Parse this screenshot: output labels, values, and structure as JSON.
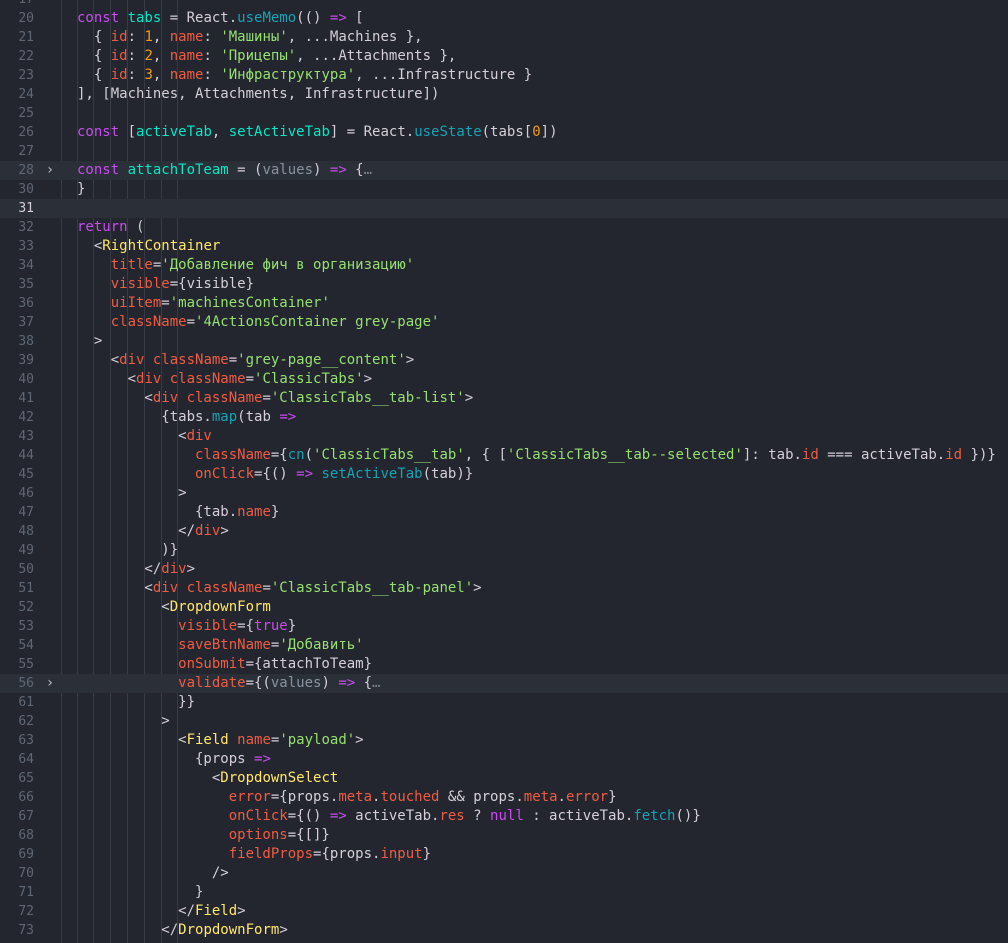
{
  "editor": {
    "language": "jsx",
    "theme_colors": {
      "background": "#23262e",
      "keyword": "#c74ded",
      "string": "#96e072",
      "tag": "#ffe66d",
      "attribute": "#ee5d43",
      "function": "#16a3b6",
      "number": "#f39c12"
    },
    "fold_icon": "chevron-right-icon",
    "current_line": 31,
    "lines": [
      {
        "n": "17",
        "fold": false,
        "hl": false,
        "segs": []
      },
      {
        "n": "20",
        "fold": false,
        "hl": false,
        "segs": [
          [
            "k",
            "const "
          ],
          [
            "v",
            "tabs"
          ],
          [
            "p",
            " = React."
          ],
          [
            "f",
            "useMemo"
          ],
          [
            "p",
            "(() "
          ],
          [
            "k",
            "=>"
          ],
          [
            "p",
            " ["
          ]
        ]
      },
      {
        "n": "21",
        "fold": false,
        "hl": false,
        "segs": [
          [
            "p",
            "  { "
          ],
          [
            "a",
            "id"
          ],
          [
            "p",
            ": "
          ],
          [
            "n",
            "1"
          ],
          [
            "p",
            ", "
          ],
          [
            "a",
            "name"
          ],
          [
            "p",
            ": "
          ],
          [
            "s",
            "'Машины'"
          ],
          [
            "p",
            ", ...Machines },"
          ]
        ]
      },
      {
        "n": "22",
        "fold": false,
        "hl": false,
        "segs": [
          [
            "p",
            "  { "
          ],
          [
            "a",
            "id"
          ],
          [
            "p",
            ": "
          ],
          [
            "n",
            "2"
          ],
          [
            "p",
            ", "
          ],
          [
            "a",
            "name"
          ],
          [
            "p",
            ": "
          ],
          [
            "s",
            "'Прицепы'"
          ],
          [
            "p",
            ", ...Attachments },"
          ]
        ]
      },
      {
        "n": "23",
        "fold": false,
        "hl": false,
        "segs": [
          [
            "p",
            "  { "
          ],
          [
            "a",
            "id"
          ],
          [
            "p",
            ": "
          ],
          [
            "n",
            "3"
          ],
          [
            "p",
            ", "
          ],
          [
            "a",
            "name"
          ],
          [
            "p",
            ": "
          ],
          [
            "s",
            "'Инфраструктура'"
          ],
          [
            "p",
            ", ...Infrastructure }"
          ]
        ]
      },
      {
        "n": "24",
        "fold": false,
        "hl": false,
        "segs": [
          [
            "p",
            "], [Machines, Attachments, Infrastructure])"
          ]
        ]
      },
      {
        "n": "25",
        "fold": false,
        "hl": false,
        "segs": []
      },
      {
        "n": "26",
        "fold": false,
        "hl": false,
        "segs": [
          [
            "k",
            "const "
          ],
          [
            "p",
            "["
          ],
          [
            "v",
            "activeTab"
          ],
          [
            "p",
            ", "
          ],
          [
            "v",
            "setActiveTab"
          ],
          [
            "p",
            "] = React."
          ],
          [
            "f",
            "useState"
          ],
          [
            "p",
            "(tabs["
          ],
          [
            "n",
            "0"
          ],
          [
            "p",
            "])"
          ]
        ]
      },
      {
        "n": "27",
        "fold": false,
        "hl": false,
        "segs": []
      },
      {
        "n": "28",
        "fold": true,
        "hl": true,
        "segs": [
          [
            "k",
            "const "
          ],
          [
            "v",
            "attachToTeam"
          ],
          [
            "p",
            " = ("
          ],
          [
            "d",
            "values"
          ],
          [
            "p",
            ") "
          ],
          [
            "k",
            "=>"
          ],
          [
            "p",
            " {"
          ],
          [
            "c",
            "…"
          ]
        ]
      },
      {
        "n": "30",
        "fold": false,
        "hl": false,
        "segs": [
          [
            "p",
            "}"
          ]
        ]
      },
      {
        "n": "31",
        "fold": false,
        "hl": true,
        "segs": []
      },
      {
        "n": "32",
        "fold": false,
        "hl": false,
        "segs": [
          [
            "k",
            "return"
          ],
          [
            "p",
            " ("
          ]
        ]
      },
      {
        "n": "33",
        "fold": false,
        "hl": false,
        "segs": [
          [
            "p",
            "  <"
          ],
          [
            "t",
            "RightContainer"
          ]
        ]
      },
      {
        "n": "34",
        "fold": false,
        "hl": false,
        "segs": [
          [
            "a",
            "    title"
          ],
          [
            "p",
            "="
          ],
          [
            "s",
            "'Добавление фич в организацию'"
          ]
        ]
      },
      {
        "n": "35",
        "fold": false,
        "hl": false,
        "segs": [
          [
            "a",
            "    visible"
          ],
          [
            "p",
            "={visible}"
          ]
        ]
      },
      {
        "n": "36",
        "fold": false,
        "hl": false,
        "segs": [
          [
            "a",
            "    uiItem"
          ],
          [
            "p",
            "="
          ],
          [
            "s",
            "'machinesContainer'"
          ]
        ]
      },
      {
        "n": "37",
        "fold": false,
        "hl": false,
        "segs": [
          [
            "a",
            "    className"
          ],
          [
            "p",
            "="
          ],
          [
            "s",
            "'4ActionsContainer grey-page'"
          ]
        ]
      },
      {
        "n": "38",
        "fold": false,
        "hl": false,
        "segs": [
          [
            "p",
            "  >"
          ]
        ]
      },
      {
        "n": "39",
        "fold": false,
        "hl": false,
        "segs": [
          [
            "p",
            "    <"
          ],
          [
            "o",
            "div "
          ],
          [
            "a",
            "className"
          ],
          [
            "p",
            "="
          ],
          [
            "s",
            "'grey-page__content'"
          ],
          [
            "p",
            ">"
          ]
        ]
      },
      {
        "n": "40",
        "fold": false,
        "hl": false,
        "segs": [
          [
            "p",
            "      <"
          ],
          [
            "o",
            "div "
          ],
          [
            "a",
            "className"
          ],
          [
            "p",
            "="
          ],
          [
            "s",
            "'ClassicTabs'"
          ],
          [
            "p",
            ">"
          ]
        ]
      },
      {
        "n": "41",
        "fold": false,
        "hl": false,
        "segs": [
          [
            "p",
            "        <"
          ],
          [
            "o",
            "div "
          ],
          [
            "a",
            "className"
          ],
          [
            "p",
            "="
          ],
          [
            "s",
            "'ClassicTabs__tab-list'"
          ],
          [
            "p",
            ">"
          ]
        ]
      },
      {
        "n": "42",
        "fold": false,
        "hl": false,
        "segs": [
          [
            "p",
            "          {tabs."
          ],
          [
            "f",
            "map"
          ],
          [
            "p",
            "(tab "
          ],
          [
            "k",
            "=>"
          ]
        ]
      },
      {
        "n": "43",
        "fold": false,
        "hl": false,
        "segs": [
          [
            "p",
            "            <"
          ],
          [
            "o",
            "div"
          ]
        ]
      },
      {
        "n": "44",
        "fold": false,
        "hl": false,
        "segs": [
          [
            "a",
            "              className"
          ],
          [
            "p",
            "={"
          ],
          [
            "f",
            "cn"
          ],
          [
            "p",
            "("
          ],
          [
            "s",
            "'ClassicTabs__tab'"
          ],
          [
            "p",
            ", { ["
          ],
          [
            "s",
            "'ClassicTabs__tab--selected'"
          ],
          [
            "p",
            "]: tab."
          ],
          [
            "a",
            "id"
          ],
          [
            "p",
            " === activeTab."
          ],
          [
            "a",
            "id"
          ],
          [
            "p",
            " })}"
          ]
        ]
      },
      {
        "n": "45",
        "fold": false,
        "hl": false,
        "segs": [
          [
            "a",
            "              onClick"
          ],
          [
            "p",
            "={() "
          ],
          [
            "k",
            "=>"
          ],
          [
            "p",
            " "
          ],
          [
            "f",
            "setActiveTab"
          ],
          [
            "p",
            "(tab)}"
          ]
        ]
      },
      {
        "n": "46",
        "fold": false,
        "hl": false,
        "segs": [
          [
            "p",
            "            >"
          ]
        ]
      },
      {
        "n": "47",
        "fold": false,
        "hl": false,
        "segs": [
          [
            "p",
            "              {tab."
          ],
          [
            "a",
            "name"
          ],
          [
            "p",
            "}"
          ]
        ]
      },
      {
        "n": "48",
        "fold": false,
        "hl": false,
        "segs": [
          [
            "p",
            "            </"
          ],
          [
            "o",
            "div"
          ],
          [
            "p",
            ">"
          ]
        ]
      },
      {
        "n": "49",
        "fold": false,
        "hl": false,
        "segs": [
          [
            "p",
            "          )}"
          ]
        ]
      },
      {
        "n": "50",
        "fold": false,
        "hl": false,
        "segs": [
          [
            "p",
            "        </"
          ],
          [
            "o",
            "div"
          ],
          [
            "p",
            ">"
          ]
        ]
      },
      {
        "n": "51",
        "fold": false,
        "hl": false,
        "segs": [
          [
            "p",
            "        <"
          ],
          [
            "o",
            "div "
          ],
          [
            "a",
            "className"
          ],
          [
            "p",
            "="
          ],
          [
            "s",
            "'ClassicTabs__tab-panel'"
          ],
          [
            "p",
            ">"
          ]
        ]
      },
      {
        "n": "52",
        "fold": false,
        "hl": false,
        "segs": [
          [
            "p",
            "          <"
          ],
          [
            "t",
            "DropdownForm"
          ]
        ]
      },
      {
        "n": "53",
        "fold": false,
        "hl": false,
        "segs": [
          [
            "a",
            "            visible"
          ],
          [
            "p",
            "={"
          ],
          [
            "k",
            "true"
          ],
          [
            "p",
            "}"
          ]
        ]
      },
      {
        "n": "54",
        "fold": false,
        "hl": false,
        "segs": [
          [
            "a",
            "            saveBtnName"
          ],
          [
            "p",
            "="
          ],
          [
            "s",
            "'Добавить'"
          ]
        ]
      },
      {
        "n": "55",
        "fold": false,
        "hl": false,
        "segs": [
          [
            "a",
            "            onSubmit"
          ],
          [
            "p",
            "={attachToTeam}"
          ]
        ]
      },
      {
        "n": "56",
        "fold": true,
        "hl": true,
        "segs": [
          [
            "a",
            "            validate"
          ],
          [
            "p",
            "={("
          ],
          [
            "d",
            "values"
          ],
          [
            "p",
            ") "
          ],
          [
            "k",
            "=>"
          ],
          [
            "p",
            " {"
          ],
          [
            "c",
            "…"
          ]
        ]
      },
      {
        "n": "61",
        "fold": false,
        "hl": false,
        "segs": [
          [
            "p",
            "            }}"
          ]
        ]
      },
      {
        "n": "62",
        "fold": false,
        "hl": false,
        "segs": [
          [
            "p",
            "          >"
          ]
        ]
      },
      {
        "n": "63",
        "fold": false,
        "hl": false,
        "segs": [
          [
            "p",
            "            <"
          ],
          [
            "t",
            "Field "
          ],
          [
            "a",
            "name"
          ],
          [
            "p",
            "="
          ],
          [
            "s",
            "'payload'"
          ],
          [
            "p",
            ">"
          ]
        ]
      },
      {
        "n": "64",
        "fold": false,
        "hl": false,
        "segs": [
          [
            "p",
            "              {props "
          ],
          [
            "k",
            "=>"
          ]
        ]
      },
      {
        "n": "65",
        "fold": false,
        "hl": false,
        "segs": [
          [
            "p",
            "                <"
          ],
          [
            "t",
            "DropdownSelect"
          ]
        ]
      },
      {
        "n": "66",
        "fold": false,
        "hl": false,
        "segs": [
          [
            "a",
            "                  error"
          ],
          [
            "p",
            "={props."
          ],
          [
            "a",
            "meta"
          ],
          [
            "p",
            "."
          ],
          [
            "a",
            "touched"
          ],
          [
            "p",
            " && props."
          ],
          [
            "a",
            "meta"
          ],
          [
            "p",
            "."
          ],
          [
            "a",
            "error"
          ],
          [
            "p",
            "}"
          ]
        ]
      },
      {
        "n": "67",
        "fold": false,
        "hl": false,
        "segs": [
          [
            "a",
            "                  onClick"
          ],
          [
            "p",
            "={() "
          ],
          [
            "k",
            "=>"
          ],
          [
            "p",
            " activeTab."
          ],
          [
            "a",
            "res"
          ],
          [
            "p",
            " ? "
          ],
          [
            "k",
            "null"
          ],
          [
            "p",
            " : activeTab."
          ],
          [
            "f",
            "fetch"
          ],
          [
            "p",
            "()}"
          ]
        ]
      },
      {
        "n": "68",
        "fold": false,
        "hl": false,
        "segs": [
          [
            "a",
            "                  options"
          ],
          [
            "p",
            "={[]}"
          ]
        ]
      },
      {
        "n": "69",
        "fold": false,
        "hl": false,
        "segs": [
          [
            "a",
            "                  fieldProps"
          ],
          [
            "p",
            "={props."
          ],
          [
            "a",
            "input"
          ],
          [
            "p",
            "}"
          ]
        ]
      },
      {
        "n": "70",
        "fold": false,
        "hl": false,
        "segs": [
          [
            "p",
            "                />"
          ]
        ]
      },
      {
        "n": "71",
        "fold": false,
        "hl": false,
        "segs": [
          [
            "p",
            "              }"
          ]
        ]
      },
      {
        "n": "72",
        "fold": false,
        "hl": false,
        "segs": [
          [
            "p",
            "            </"
          ],
          [
            "t",
            "Field"
          ],
          [
            "p",
            ">"
          ]
        ]
      },
      {
        "n": "73",
        "fold": false,
        "hl": false,
        "segs": [
          [
            "p",
            "          </"
          ],
          [
            "t",
            "DropdownForm"
          ],
          [
            "p",
            ">"
          ]
        ]
      }
    ]
  }
}
